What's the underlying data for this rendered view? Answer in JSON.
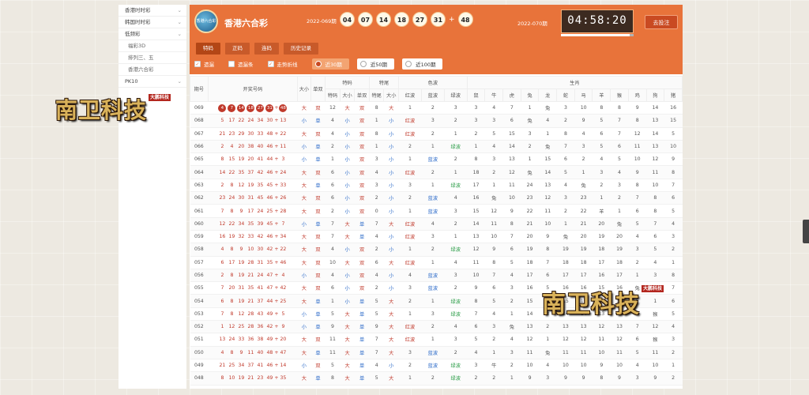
{
  "sidebar": {
    "items": [
      {
        "label": "香港时时彩",
        "sub": false
      },
      {
        "label": "韩国时时彩",
        "sub": false
      },
      {
        "label": "低频彩",
        "sub": false
      },
      {
        "label": "福彩3D",
        "sub": true
      },
      {
        "label": "排列三、五",
        "sub": true
      },
      {
        "label": "香港六合彩",
        "sub": true
      },
      {
        "label": "PK10",
        "sub": false
      }
    ]
  },
  "header": {
    "logo_text": "香港六合彩",
    "title": "香港六合彩",
    "issue": "2022-069期",
    "balls": [
      "04",
      "07",
      "14",
      "18",
      "27",
      "31"
    ],
    "plus": "+",
    "special": "48",
    "next_issue": "2022-070期",
    "countdown": "04:58:20",
    "countdown_progress": 0.95,
    "bet_button": "去投注",
    "tabs": [
      "特码",
      "正码",
      "连码",
      "历史记录"
    ],
    "filters": {
      "checks": [
        {
          "label": "遗漏",
          "checked": true
        },
        {
          "label": "遗漏条",
          "checked": false
        },
        {
          "label": "走势折线",
          "checked": true
        }
      ],
      "ranges": [
        {
          "label": "近30期",
          "active": true
        },
        {
          "label": "近50期",
          "active": false
        },
        {
          "label": "近100期",
          "active": false
        }
      ]
    }
  },
  "table": {
    "group_headers": [
      "期号",
      "开奖号码",
      "大小",
      "单双",
      "特码",
      "特尾",
      "色波",
      "生肖"
    ],
    "sub_headers": {
      "tema": [
        "特码",
        "大小",
        "单双"
      ],
      "tewei": [
        "特尾",
        "大小"
      ],
      "sebo": [
        "红波",
        "蓝波",
        "绿波"
      ],
      "shengxiao": [
        "鼠",
        "牛",
        "虎",
        "兔",
        "龙",
        "蛇",
        "马",
        "羊",
        "猴",
        "鸡",
        "狗",
        "猪"
      ]
    },
    "rows": [
      {
        "issue": "069",
        "nums": [
          "4",
          "7",
          "14",
          "18",
          "27",
          "31"
        ],
        "sp": "48",
        "dx": "大",
        "ds": "双",
        "tm": "12",
        "tdx": "大",
        "tds": "双",
        "tw": "8",
        "twdx": "大",
        "hb": "1",
        "lb": "2",
        "gb": "3",
        "sx": [
          "3",
          "4",
          "7",
          "1",
          "兔",
          "3",
          "10",
          "8",
          "8",
          "9",
          "14",
          "16"
        ]
      },
      {
        "issue": "068",
        "nums": [
          "5",
          "17",
          "22",
          "24",
          "34",
          "30"
        ],
        "sp": "13",
        "dx": "小",
        "ds": "单",
        "tm": "4",
        "tdx": "小",
        "tds": "双",
        "tw": "1",
        "twdx": "小",
        "hb": "红波",
        "lb": "3",
        "gb": "2",
        "sx": [
          "3",
          "3",
          "6",
          "兔",
          "4",
          "2",
          "9",
          "5",
          "7",
          "8",
          "13",
          "15"
        ]
      },
      {
        "issue": "067",
        "nums": [
          "21",
          "23",
          "29",
          "30",
          "33",
          "48"
        ],
        "sp": "22",
        "dx": "大",
        "ds": "双",
        "tm": "4",
        "tdx": "小",
        "tds": "双",
        "tw": "8",
        "twdx": "小",
        "hb": "红波",
        "lb": "2",
        "gb": "1",
        "sx": [
          "2",
          "5",
          "15",
          "3",
          "1",
          "8",
          "4",
          "6",
          "7",
          "12",
          "14",
          "5"
        ]
      },
      {
        "issue": "066",
        "nums": [
          "2",
          "4",
          "20",
          "38",
          "40",
          "46"
        ],
        "sp": "11",
        "dx": "小",
        "ds": "单",
        "tm": "2",
        "tdx": "小",
        "tds": "双",
        "tw": "1",
        "twdx": "小",
        "hb": "2",
        "lb": "1",
        "gb": "绿波",
        "sx": [
          "1",
          "4",
          "14",
          "2",
          "兔",
          "7",
          "3",
          "5",
          "6",
          "11",
          "13",
          "10"
        ]
      },
      {
        "issue": "065",
        "nums": [
          "8",
          "15",
          "19",
          "20",
          "41",
          "44"
        ],
        "sp": "3",
        "dx": "小",
        "ds": "单",
        "tm": "1",
        "tdx": "小",
        "tds": "双",
        "tw": "3",
        "twdx": "小",
        "hb": "1",
        "lb": "蓝波",
        "gb": "2",
        "sx": [
          "8",
          "3",
          "13",
          "1",
          "15",
          "6",
          "2",
          "4",
          "5",
          "10",
          "12",
          "9"
        ]
      },
      {
        "issue": "064",
        "nums": [
          "14",
          "22",
          "35",
          "37",
          "42",
          "46"
        ],
        "sp": "24",
        "dx": "大",
        "ds": "双",
        "tm": "6",
        "tdx": "小",
        "tds": "双",
        "tw": "4",
        "twdx": "小",
        "hb": "红波",
        "lb": "2",
        "gb": "1",
        "sx": [
          "18",
          "2",
          "12",
          "兔",
          "14",
          "5",
          "1",
          "3",
          "4",
          "9",
          "11",
          "8"
        ]
      },
      {
        "issue": "063",
        "nums": [
          "2",
          "8",
          "12",
          "19",
          "35",
          "45"
        ],
        "sp": "33",
        "dx": "大",
        "ds": "单",
        "tm": "6",
        "tdx": "小",
        "tds": "双",
        "tw": "3",
        "twdx": "小",
        "hb": "3",
        "lb": "1",
        "gb": "绿波",
        "sx": [
          "17",
          "1",
          "11",
          "24",
          "13",
          "4",
          "兔",
          "2",
          "3",
          "8",
          "10",
          "7"
        ]
      },
      {
        "issue": "062",
        "nums": [
          "23",
          "24",
          "30",
          "31",
          "45",
          "46"
        ],
        "sp": "26",
        "dx": "大",
        "ds": "双",
        "tm": "6",
        "tdx": "小",
        "tds": "双",
        "tw": "2",
        "twdx": "小",
        "hb": "2",
        "lb": "蓝波",
        "gb": "4",
        "sx": [
          "16",
          "兔",
          "10",
          "23",
          "12",
          "3",
          "23",
          "1",
          "2",
          "7",
          "8",
          "6"
        ]
      },
      {
        "issue": "061",
        "nums": [
          "7",
          "8",
          "9",
          "17",
          "24",
          "25"
        ],
        "sp": "28",
        "dx": "大",
        "ds": "双",
        "tm": "2",
        "tdx": "小",
        "tds": "双",
        "tw": "0",
        "twdx": "小",
        "hb": "1",
        "lb": "蓝波",
        "gb": "3",
        "sx": [
          "15",
          "12",
          "9",
          "22",
          "11",
          "2",
          "22",
          "羊",
          "1",
          "6",
          "8",
          "5"
        ]
      },
      {
        "issue": "060",
        "nums": [
          "12",
          "22",
          "34",
          "35",
          "39",
          "45"
        ],
        "sp": "7",
        "dx": "小",
        "ds": "单",
        "tm": "7",
        "tdx": "大",
        "tds": "单",
        "tw": "7",
        "twdx": "大",
        "hb": "红波",
        "lb": "4",
        "gb": "2",
        "sx": [
          "14",
          "11",
          "8",
          "21",
          "10",
          "1",
          "21",
          "20",
          "兔",
          "5",
          "7",
          "4"
        ]
      },
      {
        "issue": "059",
        "nums": [
          "16",
          "19",
          "32",
          "33",
          "42",
          "46"
        ],
        "sp": "34",
        "dx": "大",
        "ds": "双",
        "tm": "7",
        "tdx": "大",
        "tds": "单",
        "tw": "4",
        "twdx": "小",
        "hb": "红波",
        "lb": "3",
        "gb": "1",
        "sx": [
          "13",
          "10",
          "7",
          "20",
          "9",
          "兔",
          "20",
          "19",
          "20",
          "4",
          "6",
          "3"
        ]
      },
      {
        "issue": "058",
        "nums": [
          "4",
          "8",
          "9",
          "10",
          "30",
          "42"
        ],
        "sp": "22",
        "dx": "大",
        "ds": "双",
        "tm": "4",
        "tdx": "小",
        "tds": "双",
        "tw": "2",
        "twdx": "小",
        "hb": "1",
        "lb": "2",
        "gb": "绿波",
        "sx": [
          "12",
          "9",
          "6",
          "19",
          "8",
          "19",
          "19",
          "18",
          "19",
          "3",
          "5",
          "2"
        ]
      },
      {
        "issue": "057",
        "nums": [
          "6",
          "17",
          "19",
          "28",
          "31",
          "35"
        ],
        "sp": "46",
        "dx": "大",
        "ds": "双",
        "tm": "10",
        "tdx": "大",
        "tds": "双",
        "tw": "6",
        "twdx": "大",
        "hb": "红波",
        "lb": "1",
        "gb": "4",
        "sx": [
          "11",
          "8",
          "5",
          "18",
          "7",
          "18",
          "18",
          "17",
          "18",
          "2",
          "4",
          "1"
        ]
      },
      {
        "issue": "056",
        "nums": [
          "2",
          "8",
          "19",
          "21",
          "24",
          "47"
        ],
        "sp": "4",
        "dx": "小",
        "ds": "双",
        "tm": "4",
        "tdx": "小",
        "tds": "双",
        "tw": "4",
        "twdx": "小",
        "hb": "4",
        "lb": "蓝波",
        "gb": "3",
        "sx": [
          "10",
          "7",
          "4",
          "17",
          "6",
          "17",
          "17",
          "16",
          "17",
          "1",
          "3",
          "8"
        ]
      },
      {
        "issue": "055",
        "nums": [
          "7",
          "20",
          "31",
          "35",
          "41",
          "47"
        ],
        "sp": "42",
        "dx": "大",
        "ds": "双",
        "tm": "6",
        "tdx": "小",
        "tds": "双",
        "tw": "2",
        "twdx": "小",
        "hb": "3",
        "lb": "蓝波",
        "gb": "2",
        "sx": [
          "9",
          "6",
          "3",
          "16",
          "5",
          "16",
          "16",
          "15",
          "16",
          "兔",
          "2",
          "7"
        ]
      },
      {
        "issue": "054",
        "nums": [
          "6",
          "8",
          "19",
          "21",
          "37",
          "44"
        ],
        "sp": "25",
        "dx": "大",
        "ds": "单",
        "tm": "1",
        "tdx": "小",
        "tds": "单",
        "tw": "5",
        "twdx": "大",
        "hb": "2",
        "lb": "1",
        "gb": "绿波",
        "sx": [
          "8",
          "5",
          "2",
          "15",
          "4",
          "15",
          "15",
          "14",
          "15",
          "9",
          "1",
          "6"
        ]
      },
      {
        "issue": "053",
        "nums": [
          "7",
          "8",
          "12",
          "28",
          "43",
          "49"
        ],
        "sp": "5",
        "dx": "小",
        "ds": "单",
        "tm": "5",
        "tdx": "大",
        "tds": "单",
        "tw": "5",
        "twdx": "大",
        "hb": "1",
        "lb": "3",
        "gb": "绿波",
        "sx": [
          "7",
          "4",
          "1",
          "14",
          "3",
          "14",
          "14",
          "13",
          "14",
          "8",
          "猴",
          "5"
        ]
      },
      {
        "issue": "052",
        "nums": [
          "1",
          "12",
          "25",
          "28",
          "36",
          "42"
        ],
        "sp": "9",
        "dx": "小",
        "ds": "单",
        "tm": "9",
        "tdx": "大",
        "tds": "单",
        "tw": "9",
        "twdx": "大",
        "hb": "红波",
        "lb": "2",
        "gb": "4",
        "sx": [
          "6",
          "3",
          "兔",
          "13",
          "2",
          "13",
          "13",
          "12",
          "13",
          "7",
          "12",
          "4"
        ]
      },
      {
        "issue": "051",
        "nums": [
          "13",
          "24",
          "33",
          "36",
          "38",
          "49"
        ],
        "sp": "20",
        "dx": "大",
        "ds": "双",
        "tm": "11",
        "tdx": "大",
        "tds": "单",
        "tw": "7",
        "twdx": "大",
        "hb": "红波",
        "lb": "1",
        "gb": "3",
        "sx": [
          "5",
          "2",
          "4",
          "12",
          "1",
          "12",
          "12",
          "11",
          "12",
          "6",
          "猴",
          "3"
        ]
      },
      {
        "issue": "050",
        "nums": [
          "4",
          "8",
          "9",
          "11",
          "40",
          "48"
        ],
        "sp": "47",
        "dx": "大",
        "ds": "单",
        "tm": "11",
        "tdx": "大",
        "tds": "单",
        "tw": "7",
        "twdx": "大",
        "hb": "3",
        "lb": "蓝波",
        "gb": "2",
        "sx": [
          "4",
          "1",
          "3",
          "11",
          "兔",
          "11",
          "11",
          "10",
          "11",
          "5",
          "11",
          "2"
        ]
      },
      {
        "issue": "049",
        "nums": [
          "21",
          "25",
          "34",
          "37",
          "41",
          "46"
        ],
        "sp": "14",
        "dx": "小",
        "ds": "双",
        "tm": "5",
        "tdx": "大",
        "tds": "单",
        "tw": "4",
        "twdx": "小",
        "hb": "2",
        "lb": "蓝波",
        "gb": "绿波",
        "sx": [
          "3",
          "牛",
          "2",
          "10",
          "4",
          "10",
          "10",
          "9",
          "10",
          "4",
          "10",
          "1"
        ]
      },
      {
        "issue": "048",
        "nums": [
          "8",
          "10",
          "19",
          "21",
          "23",
          "49"
        ],
        "sp": "35",
        "dx": "大",
        "ds": "单",
        "tm": "8",
        "tdx": "大",
        "tds": "单",
        "tw": "5",
        "twdx": "大",
        "hb": "1",
        "lb": "2",
        "gb": "绿波",
        "sx": [
          "2",
          "2",
          "1",
          "9",
          "3",
          "9",
          "9",
          "8",
          "9",
          "3",
          "9",
          "2"
        ]
      }
    ]
  },
  "watermark": {
    "text": "南卫科技",
    "seal": "大鹏科技"
  }
}
